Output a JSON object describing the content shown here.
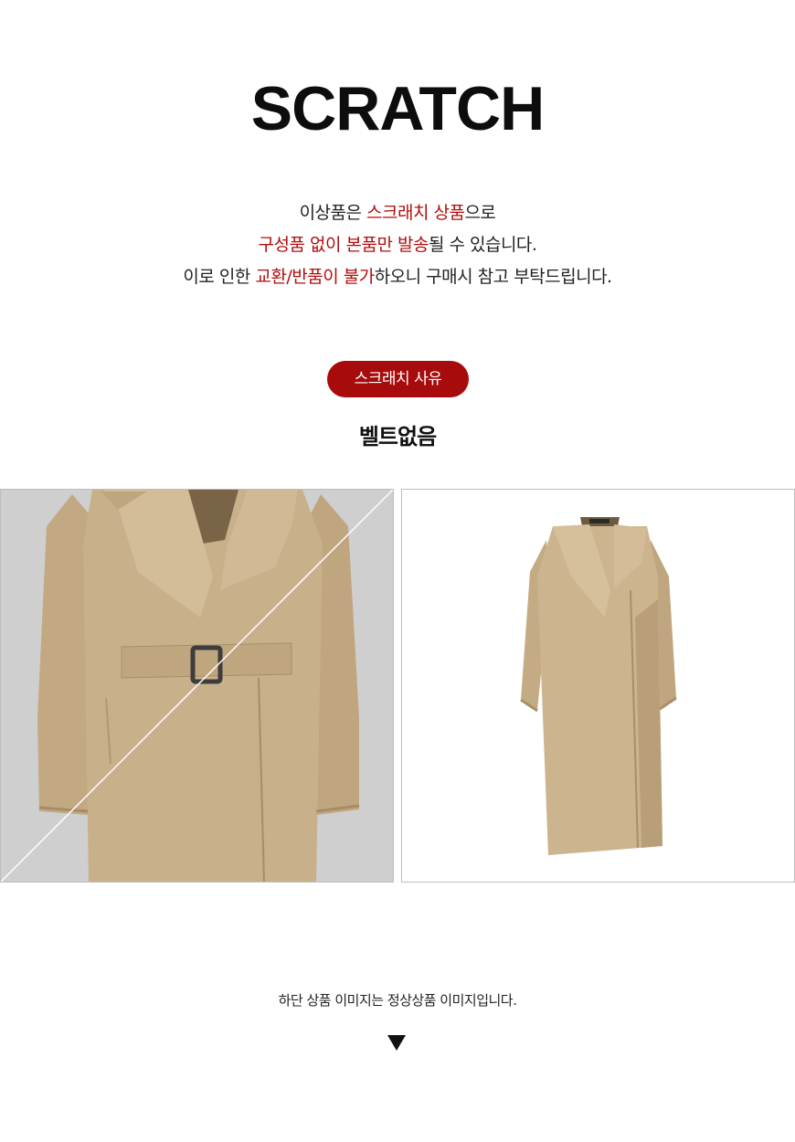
{
  "title": "SCRATCH",
  "notice": {
    "line1": {
      "pre": "이상품은 ",
      "hl": "스크래치 상품",
      "post": "으로"
    },
    "line2": {
      "hl": "구성품 없이 본품만 발송",
      "post": "될 수 있습니다."
    },
    "line3": {
      "pre": "이로 인한 ",
      "hl": "교환/반품이 불가",
      "post": "하오니 구매시 참고 부탁드립니다."
    }
  },
  "reason": {
    "label": "스크래치 사유",
    "text": "벨트없음"
  },
  "images": {
    "left": {
      "icon": "coat-closeup-image",
      "struck_through": true
    },
    "right": {
      "icon": "coat-full-image"
    }
  },
  "bottom_note": "하단 상품 이미지는 정상상품 이미지입니다.",
  "colors": {
    "accent_red": "#b10d0d",
    "pill_red": "#a80b0b",
    "coat_camel": "#c8b08a",
    "photo_bg_gray": "#cfcfcf"
  }
}
